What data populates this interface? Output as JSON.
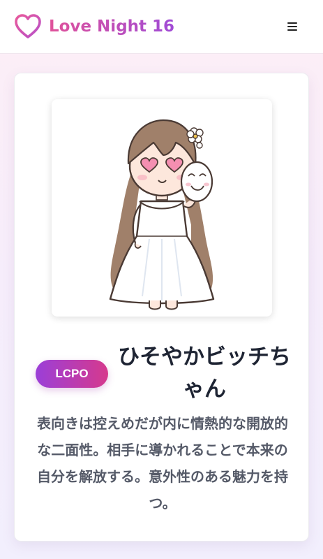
{
  "header": {
    "brand": "Love Night 16",
    "logo_icon": "heart-outline-icon",
    "menu_icon": "hamburger-menu-icon"
  },
  "result": {
    "illustration": "chibi-girl-in-white-dress-holding-mask",
    "type_code": "LCPO",
    "type_name": "ひそやかビッチちゃん",
    "description": "表向きは控えめだが内に情熱的な開放的な二面性。相手に導かれることで本来の自分を解放する。意外性のある魅力を持つ。"
  },
  "colors": {
    "brand_gradient_start": "#e0529a",
    "brand_gradient_end": "#a04bd6",
    "badge_gradient_start": "#9b3fd8",
    "badge_gradient_end": "#d6398d",
    "title_text": "#1e2433",
    "body_text": "#555a68"
  }
}
